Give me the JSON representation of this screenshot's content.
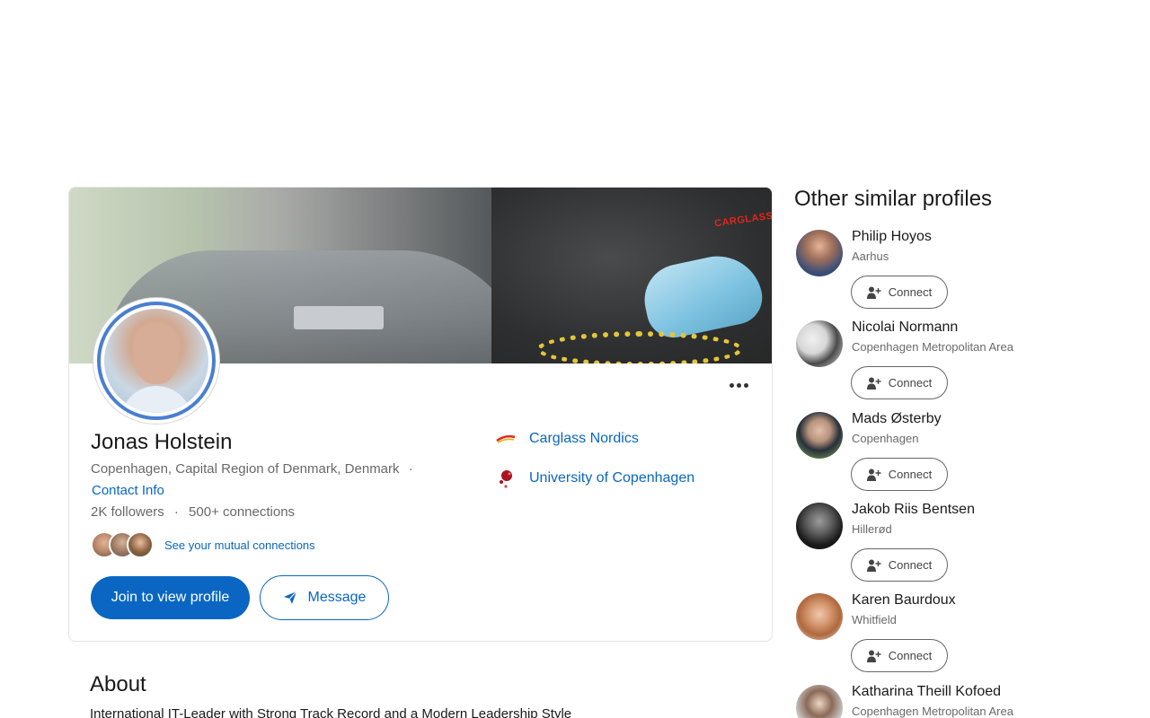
{
  "profile": {
    "name": "Jonas Holstein",
    "location": "Copenhagen, Capital Region of Denmark, Denmark",
    "separator": "·",
    "contact_info": "Contact Info",
    "followers": "2K followers",
    "connections": "500+ connections",
    "mutual_link": "See your mutual connections",
    "join_button": "Join to view profile",
    "message_button": "Message",
    "banner_brand_text": "CARGLASS"
  },
  "affiliations": [
    {
      "name": "Carglass Nordics",
      "logo_icon": "carglass-logo"
    },
    {
      "name": "University of Copenhagen",
      "logo_icon": "university-seal-logo"
    }
  ],
  "about": {
    "title": "About",
    "text": "International IT-Leader with Strong Track Record and a Modern Leadership Style"
  },
  "similar": {
    "title": "Other similar profiles",
    "connect_label": "Connect",
    "profiles": [
      {
        "name": "Philip Hoyos",
        "location": "Aarhus"
      },
      {
        "name": "Nicolai Normann",
        "location": "Copenhagen Metropolitan Area"
      },
      {
        "name": "Mads Østerby",
        "location": "Copenhagen"
      },
      {
        "name": "Jakob Riis Bentsen",
        "location": "Hillerød"
      },
      {
        "name": "Karen Baurdoux",
        "location": "Whitfield"
      },
      {
        "name": "Katharina Theill Kofoed",
        "location": "Copenhagen Metropolitan Area"
      }
    ]
  },
  "colors": {
    "link_blue": "#0a66c2",
    "primary_button": "#0a66c2",
    "brand_red": "#e1261c"
  }
}
